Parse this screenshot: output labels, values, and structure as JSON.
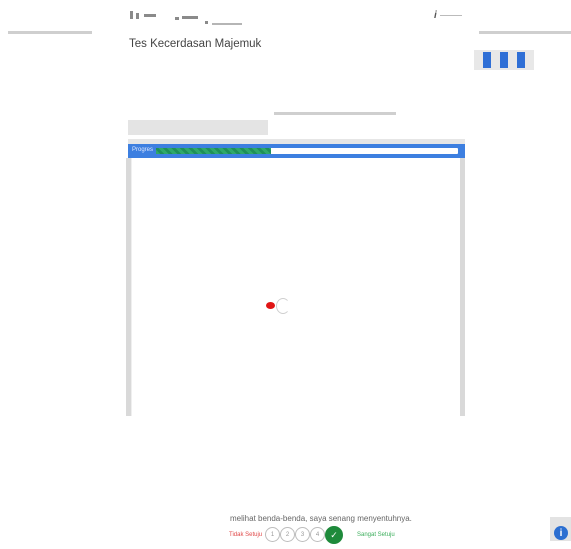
{
  "header": {
    "title": "Tes Kecerdasan Majemuk",
    "right_mark": "i"
  },
  "test": {
    "progress_label": "Progres",
    "progress_value": 0.38
  },
  "question": {
    "text": "melihat benda-benda, saya senang menyentuhnya.",
    "scale_left": "Tidak Setuju",
    "scale_right": "Sangat Setuju",
    "options": [
      "1",
      "2",
      "3",
      "4",
      "✓"
    ],
    "selected_index": 4
  },
  "colors": {
    "accent": "#3d7fe0",
    "progress_fill": "#2fa86a",
    "selected_option": "#1e8a3b",
    "disagree": "#e04848",
    "agree": "#3cae5c"
  },
  "icons": {
    "help": "info-icon",
    "loading": "spinner-icon"
  }
}
